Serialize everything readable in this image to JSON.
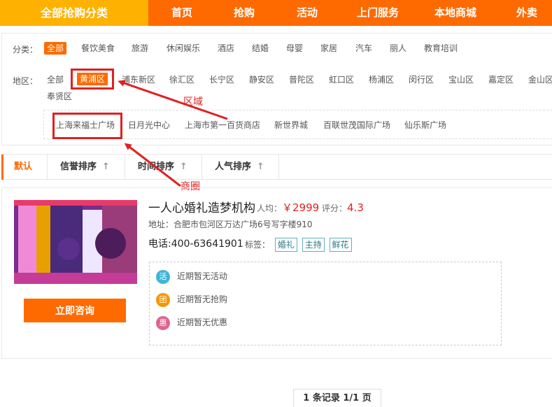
{
  "topnav": {
    "category_label": "全部抢购分类",
    "items": [
      "首页",
      "抢购",
      "活动",
      "上门服务",
      "本地商城",
      "外卖"
    ]
  },
  "filter": {
    "category_label": "分类：",
    "categories": [
      "全部",
      "餐饮美食",
      "旅游",
      "休闲娱乐",
      "酒店",
      "结婚",
      "母婴",
      "家居",
      "汽车",
      "丽人",
      "教育培训"
    ],
    "district_label": "地区：",
    "districts": [
      "全部",
      "黄浦区",
      "浦东新区",
      "徐汇区",
      "长宁区",
      "静安区",
      "普陀区",
      "虹口区",
      "杨浦区",
      "闵行区",
      "宝山区",
      "嘉定区",
      "金山区",
      "奉贤区"
    ],
    "malls": [
      "上海来福士广场",
      "日月光中心",
      "上海市第一百货商店",
      "新世界城",
      "百联世茂国际广场",
      "仙乐斯广场"
    ],
    "annotation_district": "区域",
    "annotation_mall": "商圈"
  },
  "sort": {
    "tabs": [
      "默认",
      "信誉排序",
      "时间排序",
      "人气排序"
    ],
    "up_arrow": "↑"
  },
  "listing": {
    "name": "一人心婚礼造梦机构",
    "avg_label": "人均：",
    "price": "￥2999",
    "score_label": "评分：",
    "score": "4.3",
    "address": "地址：合肥市包河区万达广场6号写字楼910",
    "phone": "电话:400-63641901",
    "tags_label": "标签：",
    "tags": [
      "婚礼",
      "主持",
      "鲜花"
    ],
    "consult_button": "立即咨询",
    "promos": [
      {
        "badge": "活",
        "text": "近期暂无活动",
        "color": "#3fb6d6"
      },
      {
        "badge": "团",
        "text": "近期暂无抢购",
        "color": "#f39800"
      },
      {
        "badge": "惠",
        "text": "近期暂无优惠",
        "color": "#e0648c"
      }
    ]
  },
  "pager": {
    "text": "1 条记录 1/1 页"
  },
  "colors": {
    "brand": "#ff6a00",
    "category_button": "#ffb100",
    "annotation": "#e02020"
  }
}
